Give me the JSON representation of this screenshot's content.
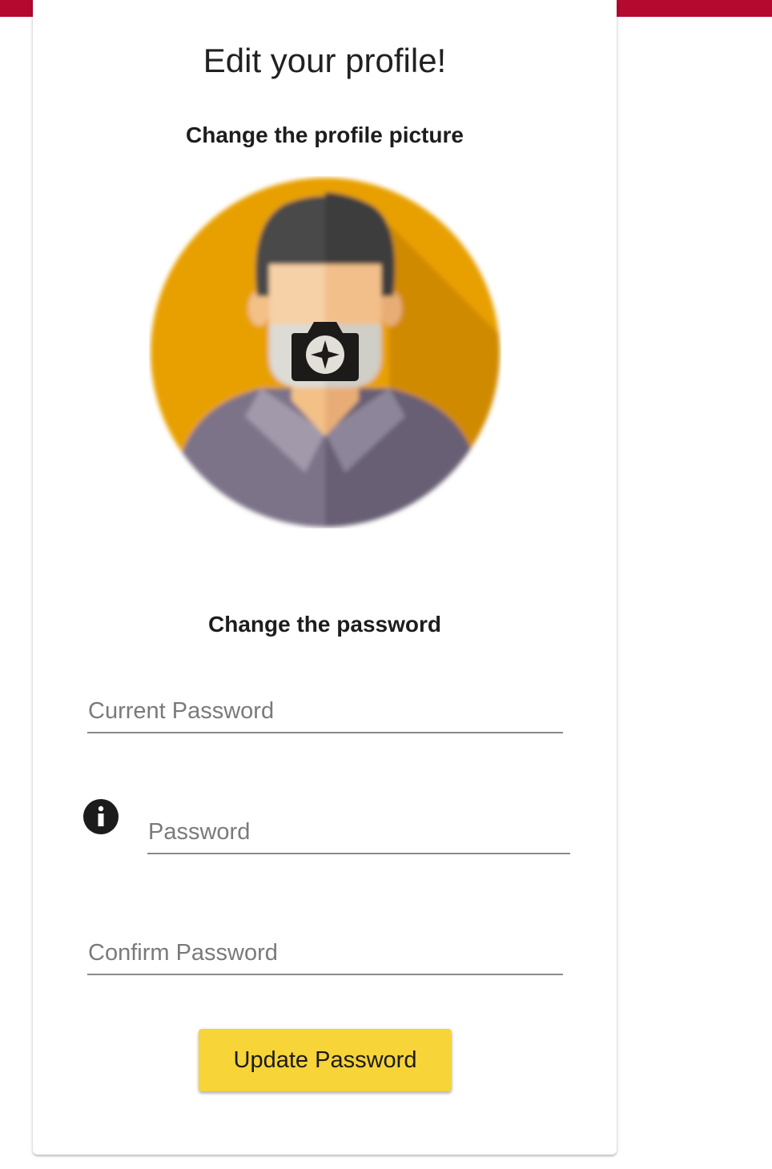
{
  "theme": {
    "topbar_color": "#b5092f",
    "button_color": "#f7d438",
    "avatar_bg": "#e8a000"
  },
  "page": {
    "title": "Edit your profile!"
  },
  "picture_section": {
    "heading": "Change the profile picture",
    "avatar_icon": "person-avatar",
    "camera_icon": "camera-icon"
  },
  "password_section": {
    "heading": "Change the password",
    "current_password": {
      "placeholder": "Current Password",
      "value": ""
    },
    "new_password": {
      "placeholder": "Password",
      "value": "",
      "info_icon": "info-icon"
    },
    "confirm_password": {
      "placeholder": "Confirm Password",
      "value": ""
    },
    "submit_label": "Update Password"
  }
}
